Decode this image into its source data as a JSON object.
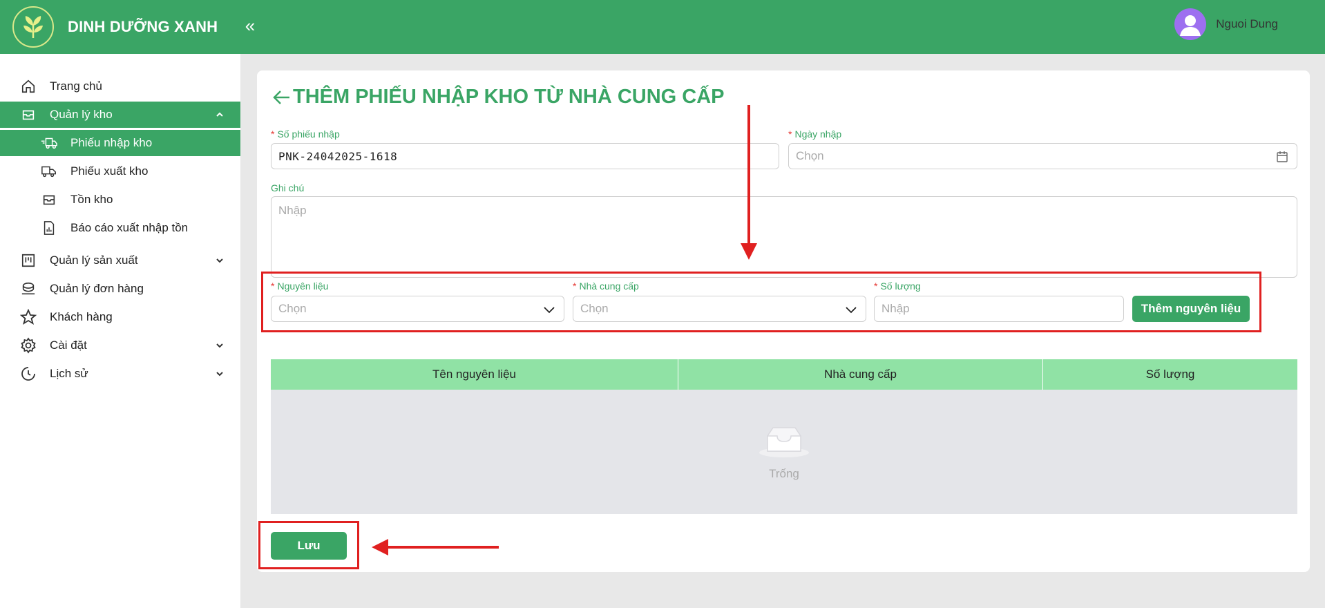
{
  "brand": {
    "name": "DINH DƯỠNG XANH",
    "collapse_icon": "double-chevron-left-icon"
  },
  "user": {
    "name": "Nguoi Dung"
  },
  "sidebar": {
    "items": [
      {
        "label": "Trang chủ",
        "icon": "home-icon"
      },
      {
        "label": "Quản lý kho",
        "icon": "inbox-icon",
        "expanded": true,
        "children": [
          {
            "label": "Phiếu nhập kho",
            "icon": "truck-in-icon",
            "active": true
          },
          {
            "label": "Phiếu xuất kho",
            "icon": "truck-out-icon"
          },
          {
            "label": "Tồn kho",
            "icon": "inbox-icon"
          },
          {
            "label": "Báo cáo xuất nhập tồn",
            "icon": "report-icon"
          }
        ]
      },
      {
        "label": "Quản lý sản xuất",
        "icon": "factory-icon"
      },
      {
        "label": "Quản lý đơn hàng",
        "icon": "orders-icon"
      },
      {
        "label": "Khách hàng",
        "icon": "star-icon"
      },
      {
        "label": "Cài đặt",
        "icon": "gear-icon"
      },
      {
        "label": "Lịch sử",
        "icon": "history-icon"
      }
    ]
  },
  "page": {
    "title": "THÊM PHIẾU NHẬP KHO TỪ NHÀ CUNG CẤP",
    "form": {
      "receipt_no": {
        "label": "Số phiếu nhập",
        "value": "PNK-24042025-1618"
      },
      "date": {
        "label": "Ngày nhập",
        "placeholder": "Chọn"
      },
      "note": {
        "label": "Ghi chú",
        "placeholder": "Nhập"
      },
      "material": {
        "label": "Nguyên liệu",
        "placeholder": "Chọn"
      },
      "supplier": {
        "label": "Nhà cung cấp",
        "placeholder": "Chọn"
      },
      "quantity": {
        "label": "Số lượng",
        "placeholder": "Nhập"
      },
      "add_button": "Thêm nguyên liệu"
    },
    "table": {
      "columns": [
        "Tên nguyên liệu",
        "Nhà cung cấp",
        "Số lượng"
      ],
      "empty_text": "Trống"
    },
    "save_button": "Lưu"
  },
  "colors": {
    "primary": "#3aa565",
    "table_header": "#90e2a5",
    "annotation": "#e02020",
    "required": "#e53935"
  }
}
